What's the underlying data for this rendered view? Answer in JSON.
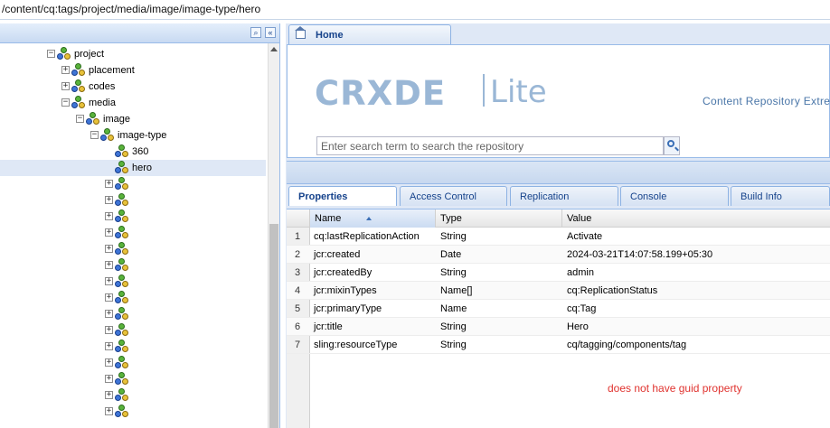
{
  "path": "/content/cq:tags/project/media/image/image-type/hero",
  "tree": {
    "nodes": [
      {
        "label": "project",
        "toggle": "minus"
      },
      {
        "label": "placement",
        "toggle": "plus"
      },
      {
        "label": "codes",
        "toggle": "plus"
      },
      {
        "label": "media",
        "toggle": "minus"
      },
      {
        "label": "image",
        "toggle": "minus"
      },
      {
        "label": "image-type",
        "toggle": "minus"
      },
      {
        "label": "360",
        "toggle": "none"
      },
      {
        "label": "hero",
        "toggle": "none",
        "selected": true
      },
      {
        "label": "",
        "toggle": "plus"
      },
      {
        "label": "",
        "toggle": "plus"
      },
      {
        "label": "",
        "toggle": "plus"
      },
      {
        "label": "",
        "toggle": "plus"
      },
      {
        "label": "",
        "toggle": "plus"
      },
      {
        "label": "",
        "toggle": "plus"
      },
      {
        "label": "",
        "toggle": "plus"
      },
      {
        "label": "",
        "toggle": "plus"
      },
      {
        "label": "",
        "toggle": "plus"
      },
      {
        "label": "",
        "toggle": "plus"
      },
      {
        "label": "",
        "toggle": "plus"
      },
      {
        "label": "",
        "toggle": "plus"
      },
      {
        "label": "",
        "toggle": "plus"
      },
      {
        "label": "",
        "toggle": "plus"
      },
      {
        "label": "",
        "toggle": "plus"
      }
    ]
  },
  "home_tab": {
    "label": "Home"
  },
  "home": {
    "logo_left": "CRXDE",
    "logo_right": "Lite",
    "tagline": "Content Repository Extreme",
    "search_placeholder": "Enter search term to search the repository"
  },
  "panel_tabs": [
    "Properties",
    "Access Control",
    "Replication",
    "Console",
    "Build Info"
  ],
  "grid": {
    "columns": [
      "Name",
      "Type",
      "Value"
    ],
    "rows": [
      {
        "n": "1",
        "name": "cq:lastReplicationAction",
        "type": "String",
        "value": "Activate"
      },
      {
        "n": "2",
        "name": "jcr:created",
        "type": "Date",
        "value": "2024-03-21T14:07:58.199+05:30"
      },
      {
        "n": "3",
        "name": "jcr:createdBy",
        "type": "String",
        "value": "admin"
      },
      {
        "n": "4",
        "name": "jcr:mixinTypes",
        "type": "Name[]",
        "value": "cq:ReplicationStatus"
      },
      {
        "n": "5",
        "name": "jcr:primaryType",
        "type": "Name",
        "value": "cq:Tag"
      },
      {
        "n": "6",
        "name": "jcr:title",
        "type": "String",
        "value": "Hero"
      },
      {
        "n": "7",
        "name": "sling:resourceType",
        "type": "String",
        "value": "cq/tagging/components/tag"
      }
    ]
  },
  "annotation": "does not have guid property",
  "colors": {
    "accent": "#15428b",
    "panel_bg": "#dfe8f6",
    "annotation": "#e0332f"
  }
}
